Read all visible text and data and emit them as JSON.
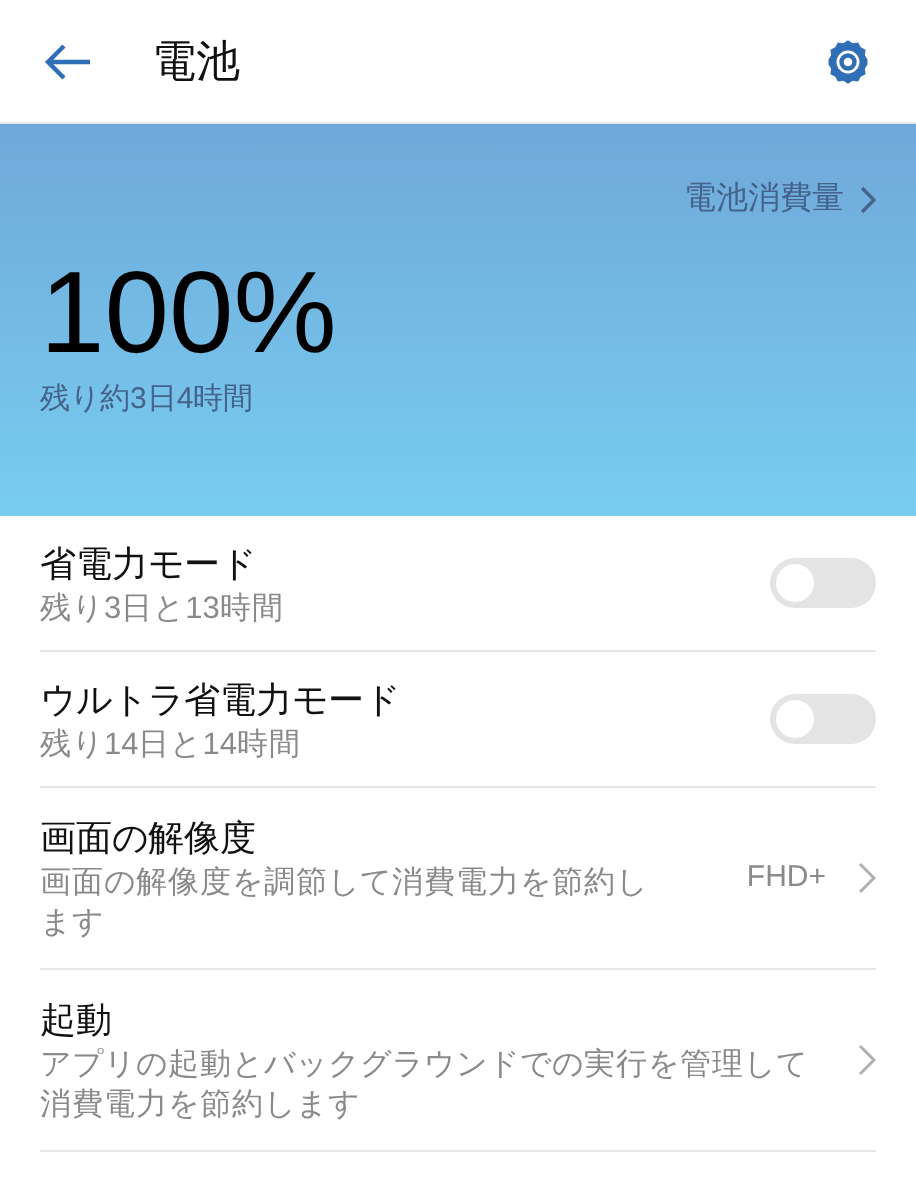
{
  "header": {
    "title": "電池"
  },
  "summary": {
    "usage_link": "電池消費量",
    "percent": "100%",
    "remaining": "残り約3日4時間"
  },
  "settings": [
    {
      "kind": "toggle",
      "title": "省電力モード",
      "subtitle": "残り3日と13時間",
      "on": false
    },
    {
      "kind": "toggle",
      "title": "ウルトラ省電力モード",
      "subtitle": "残り14日と14時間",
      "on": false
    },
    {
      "kind": "value",
      "title": "画面の解像度",
      "subtitle": "画面の解像度を調節して消費電力を節約します",
      "value": "FHD+"
    },
    {
      "kind": "link",
      "title": "起動",
      "subtitle": "アプリの起動とバックグラウンドでの実行を管理して消費電力を節約します"
    }
  ]
}
